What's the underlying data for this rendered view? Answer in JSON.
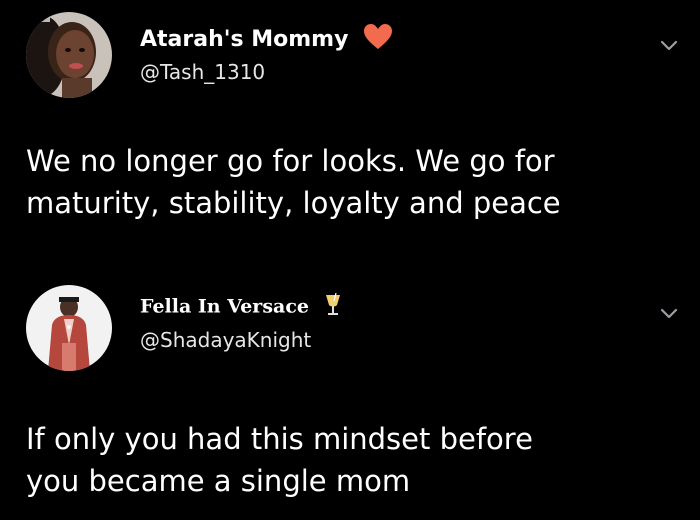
{
  "tweets": [
    {
      "display_name": "Atarah's Mommy",
      "name_emoji": "heart-icon",
      "handle": "@Tash_1310",
      "text": "We no longer go for looks. We go for\nmaturity, stability, loyalty and peace"
    },
    {
      "display_name": "Fella In Versace",
      "name_emoji": "cocktail-glass-icon",
      "handle": "@ShadayaKnight",
      "text": "If only you had this mindset before\nyou became a single mom"
    }
  ],
  "colors": {
    "background": "#000000",
    "text": "#ffffff",
    "heart": "#f26b4e",
    "chevron": "#9aa0a6"
  }
}
